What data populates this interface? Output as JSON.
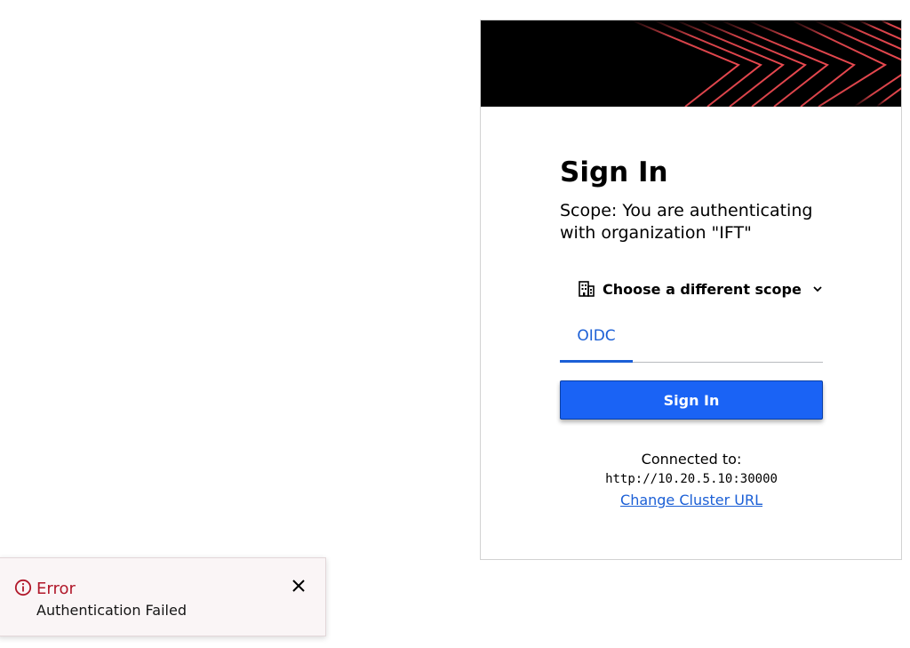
{
  "login": {
    "title": "Sign In",
    "scope_text": "Scope: You are authenticating with organization \"IFT\"",
    "scope_picker_label": "Choose a different scope",
    "tabs": [
      {
        "label": "OIDC",
        "active": true
      }
    ],
    "sign_in_button": "Sign In",
    "connected_label": "Connected to:",
    "cluster_url": "http://10.20.5.10:30000",
    "change_cluster_link": "Change Cluster URL"
  },
  "toast": {
    "title": "Error",
    "message": "Authentication Failed",
    "icon": "info-circle-icon",
    "close_icon": "close-icon"
  },
  "colors": {
    "accent": "#1a63f5",
    "link": "#1b5fd6",
    "error": "#b1182a",
    "banner_bg": "#000000",
    "banner_lines": "#e8484f"
  }
}
